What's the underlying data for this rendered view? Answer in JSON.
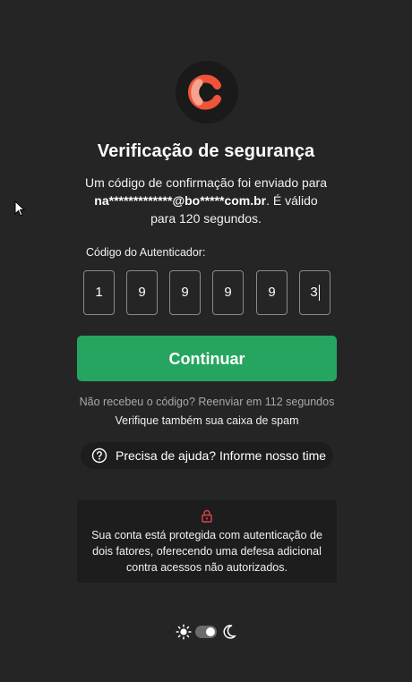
{
  "header": {
    "title": "Verificação de segurança",
    "desc_line1": "Um código de confirmação foi enviado para",
    "masked_email": "na*************@bo*****com.br",
    "desc_line2_suffix": ". É válido",
    "desc_line3": "para 120 segundos."
  },
  "code": {
    "label": "Código do Autenticador:",
    "digits": [
      "1",
      "9",
      "9",
      "9",
      "9",
      "3"
    ]
  },
  "actions": {
    "continue_label": "Continuar",
    "resend_text": "Não recebeu o código? Reenviar em 112 segundos",
    "spam_text": "Verifique também sua caixa de spam",
    "help_label": "Precisa de ajuda? Informe nosso time"
  },
  "info": {
    "text": "Sua conta está protegida com autenticação de dois fatores, oferecendo uma defesa adicional contra acessos não autorizados."
  },
  "theme": {
    "mode": "dark"
  },
  "colors": {
    "background": "#252526",
    "accent_green": "#25a55f",
    "logo_orange": "#f0533a",
    "logo_pink": "#f5a38f",
    "lock_red": "#e0424c"
  },
  "icons": [
    "brand-logo-icon",
    "help-circle-icon",
    "lock-icon",
    "sun-icon",
    "moon-icon",
    "mouse-cursor-icon"
  ]
}
